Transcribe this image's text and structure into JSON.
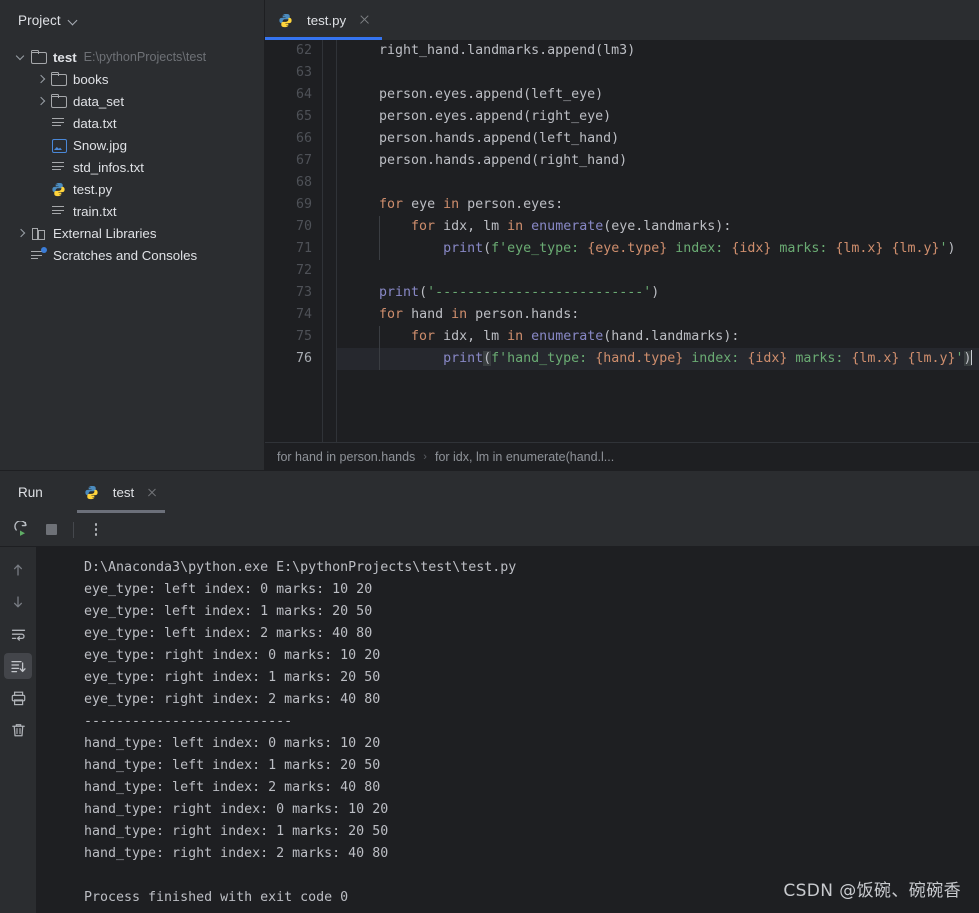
{
  "sidebar": {
    "header": {
      "title": "Project",
      "chevron_icon": "chevron-down-icon"
    },
    "tree": [
      {
        "label": "test",
        "path_hint": "E:\\pythonProjects\\test",
        "icon": "folder-icon",
        "arrow": "down",
        "depth": 0,
        "bold": true
      },
      {
        "label": "books",
        "path_hint": "",
        "icon": "folder-icon",
        "arrow": "right",
        "depth": 1,
        "bold": false
      },
      {
        "label": "data_set",
        "path_hint": "",
        "icon": "folder-icon",
        "arrow": "right",
        "depth": 1,
        "bold": false
      },
      {
        "label": "data.txt",
        "path_hint": "",
        "icon": "text-file-icon",
        "arrow": "none",
        "depth": 1,
        "bold": false
      },
      {
        "label": "Snow.jpg",
        "path_hint": "",
        "icon": "image-file-icon",
        "arrow": "none",
        "depth": 1,
        "bold": false
      },
      {
        "label": "std_infos.txt",
        "path_hint": "",
        "icon": "text-file-icon",
        "arrow": "none",
        "depth": 1,
        "bold": false
      },
      {
        "label": "test.py",
        "path_hint": "",
        "icon": "python-file-icon",
        "arrow": "none",
        "depth": 1,
        "bold": false
      },
      {
        "label": "train.txt",
        "path_hint": "",
        "icon": "text-file-icon",
        "arrow": "none",
        "depth": 1,
        "bold": false
      },
      {
        "label": "External Libraries",
        "path_hint": "",
        "icon": "library-icon",
        "arrow": "right",
        "depth": 0,
        "bold": false
      },
      {
        "label": "Scratches and Consoles",
        "path_hint": "",
        "icon": "scratches-icon",
        "arrow": "none",
        "depth": 0,
        "bold": false
      }
    ]
  },
  "editor": {
    "tab": {
      "label": "test.py",
      "icon": "python-file-icon",
      "close_icon": "close-icon",
      "active": true
    },
    "accent_color": "#3574f0",
    "first_line_number": 62,
    "active_line_number": 76,
    "lines": [
      {
        "n": 62,
        "tokens": [
          {
            "t": "    right_hand.landmarks.append(lm3)",
            "c": "ident"
          }
        ]
      },
      {
        "n": 63,
        "tokens": [
          {
            "t": "",
            "c": "ident"
          }
        ]
      },
      {
        "n": 64,
        "tokens": [
          {
            "t": "    person.eyes.append(left_eye)",
            "c": "ident"
          }
        ]
      },
      {
        "n": 65,
        "tokens": [
          {
            "t": "    person.eyes.append(right_eye)",
            "c": "ident"
          }
        ]
      },
      {
        "n": 66,
        "tokens": [
          {
            "t": "    person.hands.append(left_hand)",
            "c": "ident"
          }
        ]
      },
      {
        "n": 67,
        "tokens": [
          {
            "t": "    person.hands.append(right_hand)",
            "c": "ident"
          }
        ]
      },
      {
        "n": 68,
        "tokens": [
          {
            "t": "",
            "c": "ident"
          }
        ]
      },
      {
        "n": 69,
        "tokens": [
          {
            "t": "    ",
            "c": "ident"
          },
          {
            "t": "for",
            "c": "kw"
          },
          {
            "t": " eye ",
            "c": "ident"
          },
          {
            "t": "in",
            "c": "kw"
          },
          {
            "t": " person.eyes:",
            "c": "ident"
          }
        ]
      },
      {
        "n": 70,
        "tokens": [
          {
            "t": "        ",
            "c": "ident"
          },
          {
            "t": "for",
            "c": "kw"
          },
          {
            "t": " idx, lm ",
            "c": "ident"
          },
          {
            "t": "in",
            "c": "kw"
          },
          {
            "t": " ",
            "c": "ident"
          },
          {
            "t": "enumerate",
            "c": "fn"
          },
          {
            "t": "(eye.landmarks):",
            "c": "ident"
          }
        ]
      },
      {
        "n": 71,
        "tokens": [
          {
            "t": "            ",
            "c": "ident"
          },
          {
            "t": "print",
            "c": "fn"
          },
          {
            "t": "(",
            "c": "ident"
          },
          {
            "t": "f'eye_type: ",
            "c": "str"
          },
          {
            "t": "{eye.type}",
            "c": "brace"
          },
          {
            "t": " index: ",
            "c": "str"
          },
          {
            "t": "{idx}",
            "c": "brace"
          },
          {
            "t": " marks: ",
            "c": "str"
          },
          {
            "t": "{lm.x}",
            "c": "brace"
          },
          {
            "t": " ",
            "c": "str"
          },
          {
            "t": "{lm.y}",
            "c": "brace"
          },
          {
            "t": "'",
            "c": "str"
          },
          {
            "t": ")",
            "c": "ident"
          }
        ]
      },
      {
        "n": 72,
        "tokens": [
          {
            "t": "",
            "c": "ident"
          }
        ]
      },
      {
        "n": 73,
        "tokens": [
          {
            "t": "    ",
            "c": "ident"
          },
          {
            "t": "print",
            "c": "fn"
          },
          {
            "t": "(",
            "c": "ident"
          },
          {
            "t": "'--------------------------'",
            "c": "str"
          },
          {
            "t": ")",
            "c": "ident"
          }
        ]
      },
      {
        "n": 74,
        "tokens": [
          {
            "t": "    ",
            "c": "ident"
          },
          {
            "t": "for",
            "c": "kw"
          },
          {
            "t": " hand ",
            "c": "ident"
          },
          {
            "t": "in",
            "c": "kw"
          },
          {
            "t": " person.hands:",
            "c": "ident"
          }
        ]
      },
      {
        "n": 75,
        "tokens": [
          {
            "t": "        ",
            "c": "ident"
          },
          {
            "t": "for",
            "c": "kw"
          },
          {
            "t": " idx, lm ",
            "c": "ident"
          },
          {
            "t": "in",
            "c": "kw"
          },
          {
            "t": " ",
            "c": "ident"
          },
          {
            "t": "enumerate",
            "c": "fn"
          },
          {
            "t": "(hand.landmarks):",
            "c": "ident"
          }
        ]
      },
      {
        "n": 76,
        "tokens": [
          {
            "t": "            ",
            "c": "ident"
          },
          {
            "t": "print",
            "c": "fn"
          },
          {
            "t": "(",
            "c": "paren-hl"
          },
          {
            "t": "f'hand_type: ",
            "c": "str"
          },
          {
            "t": "{hand.type}",
            "c": "brace"
          },
          {
            "t": " index: ",
            "c": "str"
          },
          {
            "t": "{idx}",
            "c": "brace"
          },
          {
            "t": " marks: ",
            "c": "str"
          },
          {
            "t": "{lm.x}",
            "c": "brace"
          },
          {
            "t": " ",
            "c": "str"
          },
          {
            "t": "{lm.y}",
            "c": "brace"
          },
          {
            "t": "'",
            "c": "str"
          },
          {
            "t": ")",
            "c": "paren-hl"
          }
        ]
      }
    ],
    "breadcrumb": [
      "for hand in person.hands",
      "for idx, lm in enumerate(hand.l..."
    ]
  },
  "run_panel": {
    "title": "Run",
    "tab": {
      "label": "test",
      "icon": "python-file-icon",
      "close_icon": "close-icon"
    },
    "toolbar": [
      {
        "name": "rerun-button",
        "icon": "rerun-icon"
      },
      {
        "name": "stop-button",
        "icon": "stop-icon"
      },
      {
        "name": "more-options-button",
        "icon": "vertical-dots-icon"
      }
    ],
    "console_sidebar": [
      {
        "name": "scroll-up-button",
        "icon": "arrow-up-icon",
        "active": false
      },
      {
        "name": "scroll-down-button",
        "icon": "arrow-down-icon",
        "active": false
      },
      {
        "name": "soft-wrap-button",
        "icon": "soft-wrap-icon",
        "active": false
      },
      {
        "name": "scroll-to-end-button",
        "icon": "scroll-to-end-icon",
        "active": true
      },
      {
        "name": "print-button",
        "icon": "printer-icon",
        "active": false
      },
      {
        "name": "clear-all-button",
        "icon": "trash-icon",
        "active": false
      }
    ],
    "output": [
      "D:\\Anaconda3\\python.exe E:\\pythonProjects\\test\\test.py",
      "eye_type: left index: 0 marks: 10 20",
      "eye_type: left index: 1 marks: 20 50",
      "eye_type: left index: 2 marks: 40 80",
      "eye_type: right index: 0 marks: 10 20",
      "eye_type: right index: 1 marks: 20 50",
      "eye_type: right index: 2 marks: 40 80",
      "--------------------------",
      "hand_type: left index: 0 marks: 10 20",
      "hand_type: left index: 1 marks: 20 50",
      "hand_type: left index: 2 marks: 40 80",
      "hand_type: right index: 0 marks: 10 20",
      "hand_type: right index: 1 marks: 20 50",
      "hand_type: right index: 2 marks: 40 80",
      "",
      "Process finished with exit code 0"
    ]
  },
  "watermark": {
    "text": "CSDN @饭碗、碗碗香"
  }
}
